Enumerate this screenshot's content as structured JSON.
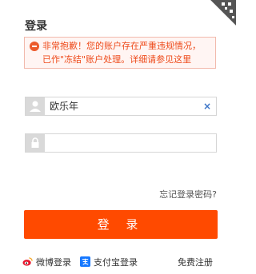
{
  "title": "登录",
  "alert": {
    "line1": "非常抱歉！您的账户存在严重违规情况，",
    "line2_prefix": "已作\"冻结\"账户处理。详细请参见",
    "line2_link": "这里",
    "icon": "minus-circle-icon",
    "color": "#ee4a1a"
  },
  "username": {
    "value": "欧乐年",
    "clear": "×",
    "icon": "user-icon"
  },
  "password": {
    "value": "",
    "icon": "lock-icon"
  },
  "forgot_link": "忘记登录密码?",
  "login_button": "登 录",
  "bottom": {
    "weibo": "微博登录",
    "alipay": "支付宝登录",
    "register": "免费注册"
  },
  "colors": {
    "accent": "#ff4a00",
    "alert_bg": "#fff5f3",
    "alert_border": "#f2b9ac"
  }
}
